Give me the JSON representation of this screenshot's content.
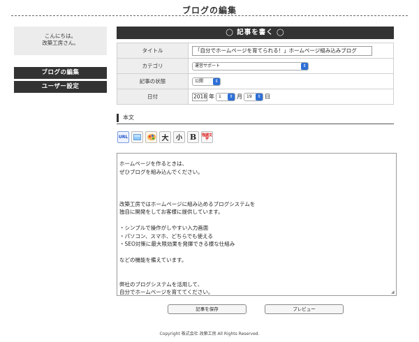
{
  "header": {
    "title": "ブログの編集"
  },
  "sidebar": {
    "greeting_line1": "こんにちは。",
    "greeting_line2": "改築工房さん。",
    "items": [
      {
        "label": "ブログの編集"
      },
      {
        "label": "ユーザー設定"
      }
    ]
  },
  "form": {
    "header": "◯ 記事を書く ◯",
    "title_label": "タイトル",
    "title_value": "「自分でホームページを育てられる！」ホームページ組み込みブログ",
    "category_label": "カテゴリ",
    "category_value": "運営サポート",
    "status_label": "記事の状態",
    "status_value": "公開",
    "date_label": "日付",
    "date": {
      "year": "2018",
      "year_unit": "年",
      "month": "1",
      "month_unit": "月",
      "day": "19",
      "day_unit": "日"
    }
  },
  "body_section": {
    "label": "本文",
    "toolbar": [
      {
        "label": "URL",
        "icon": "url-link-icon"
      },
      {
        "label": "",
        "icon": "image-insert-icon"
      },
      {
        "label": "",
        "icon": "color-palette-icon"
      },
      {
        "label": "大",
        "icon": "large-text-icon"
      },
      {
        "label": "小",
        "icon": "small-text-icon"
      },
      {
        "label": "B",
        "icon": "bold-icon"
      },
      {
        "label": "強調文字",
        "icon": "emphasis-icon"
      }
    ],
    "lines": [
      "ホームページを作るときは、",
      "ぜひブログを組み込んでください。",
      "",
      "",
      "",
      "改築工房ではホームページに組み込めるブログシステムを",
      "独自に開発をしてお客様に提供しています。",
      "",
      "・シンプルで操作がしやすい入力画面",
      "・パソコン、スマホ、どちらでも使える",
      "・SEO対策に最大限効果を発揮できる様な仕組み",
      "",
      "などの機能を備えています。",
      "",
      "",
      "弊社のブログシステムを活用して、",
      "自分でホームページを育ててください。"
    ]
  },
  "buttons": {
    "save": "記事を保存",
    "preview": "プレビュー"
  },
  "footer": {
    "copyright": "Copyright 株式会社 改築工房 All Rights Reserved."
  },
  "colors": {
    "dark": "#333333",
    "select_accent": "#2d6fd6",
    "label_bg": "#eeeeee"
  }
}
